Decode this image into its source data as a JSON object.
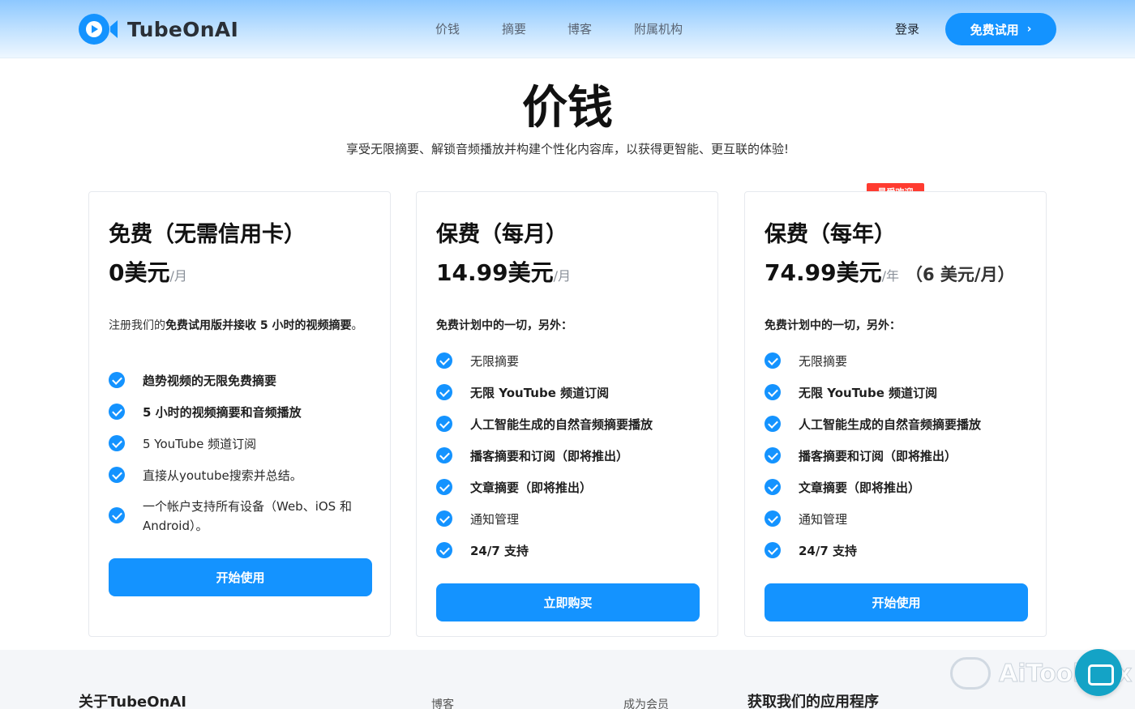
{
  "header": {
    "brand": "TubeOnAI",
    "nav": [
      "价钱",
      "摘要",
      "博客",
      "附属机构"
    ],
    "login": "登录",
    "trial": "免费试用",
    "trial_chevron": "›"
  },
  "hero": {
    "title": "价钱",
    "subtitle": "享受无限摘要、解锁音频播放并构建个性化内容库，以获得更智能、更互联的体验!"
  },
  "badge": "最受欢迎",
  "plans": [
    {
      "name": "免费（无需信用卡）",
      "price": "0美元",
      "period": "/月",
      "extra": "",
      "desc_prefix": "注册我们的",
      "desc_bold": "免费试用版并接收 5 小时的视频摘要",
      "desc_suffix": "。",
      "features": [
        {
          "text": "趋势视频的无限免费摘要",
          "bold": true
        },
        {
          "text": "5 小时的视频摘要和音频播放",
          "bold": true
        },
        {
          "text": "5 YouTube 频道订阅",
          "bold": false
        },
        {
          "text": "直接从youtube搜索并总结。",
          "bold": false
        },
        {
          "text": "一个帐户支持所有设备（Web、iOS 和 Android）。",
          "bold": false
        }
      ],
      "cta": "开始使用"
    },
    {
      "name": "保费（每月）",
      "price": "14.99美元",
      "period": "/月",
      "extra": "",
      "desc": "免费计划中的一切，另外：",
      "features": [
        {
          "text": "无限摘要",
          "bold": false
        },
        {
          "text": "无限 YouTube 频道订阅",
          "bold": true
        },
        {
          "text": "人工智能生成的自然音频摘要播放",
          "bold": true
        },
        {
          "text": "播客摘要和订阅（即将推出）",
          "bold": true
        },
        {
          "text": "文章摘要（即将推出）",
          "bold": true
        },
        {
          "text": "通知管理",
          "bold": false
        },
        {
          "text": "24/7 支持",
          "bold": true
        }
      ],
      "cta": "立即购买"
    },
    {
      "name": "保费（每年）",
      "price": "74.99美元",
      "period": "/年",
      "extra": "（6 美元/月）",
      "desc": "免费计划中的一切，另外：",
      "features": [
        {
          "text": "无限摘要",
          "bold": false
        },
        {
          "text": "无限 YouTube 频道订阅",
          "bold": true
        },
        {
          "text": "人工智能生成的自然音频摘要播放",
          "bold": true
        },
        {
          "text": "播客摘要和订阅（即将推出）",
          "bold": true
        },
        {
          "text": "文章摘要（即将推出）",
          "bold": true
        },
        {
          "text": "通知管理",
          "bold": false
        },
        {
          "text": "24/7 支持",
          "bold": true
        }
      ],
      "cta": "开始使用"
    }
  ],
  "footer": {
    "about": "关于TubeOnAI",
    "blog": "博客",
    "member": "成为会员",
    "app": "获取我们的应用程序"
  },
  "watermark": "AiToolBox",
  "colors": {
    "primary": "#1493ff",
    "badge": "#ff3b30",
    "footer_bg": "#f4f6f9"
  }
}
